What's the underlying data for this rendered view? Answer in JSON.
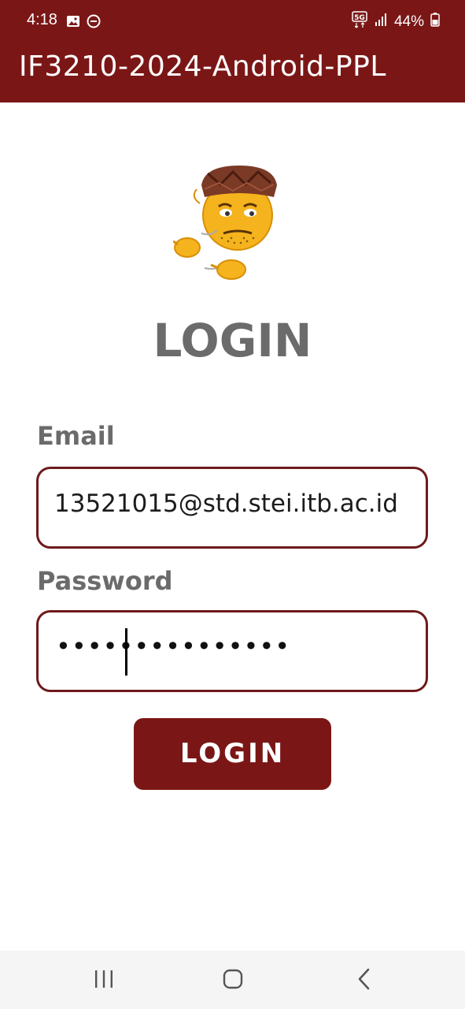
{
  "status_bar": {
    "time": "4:18",
    "battery": "44%",
    "network": "5G"
  },
  "app_bar": {
    "title": "IF3210-2024-Android-PPL"
  },
  "login": {
    "heading": "LOGIN",
    "email_label": "Email",
    "email_value": "13521015@std.stei.itb.ac.id",
    "password_label": "Password",
    "password_value": "•••••••••••••••",
    "button_label": "LOGIN"
  },
  "colors": {
    "primary": "#7a1716",
    "label_gray": "#6b6b6b",
    "input_border": "#6e1a1a"
  },
  "icons": {
    "status_left": [
      "gallery-icon",
      "do-not-disturb-icon"
    ],
    "status_right": [
      "5g-icon",
      "signal-icon",
      "battery-icon"
    ],
    "nav": [
      "recent-apps-icon",
      "home-icon",
      "back-icon"
    ],
    "mascot": "mascot-emoji-icon"
  }
}
